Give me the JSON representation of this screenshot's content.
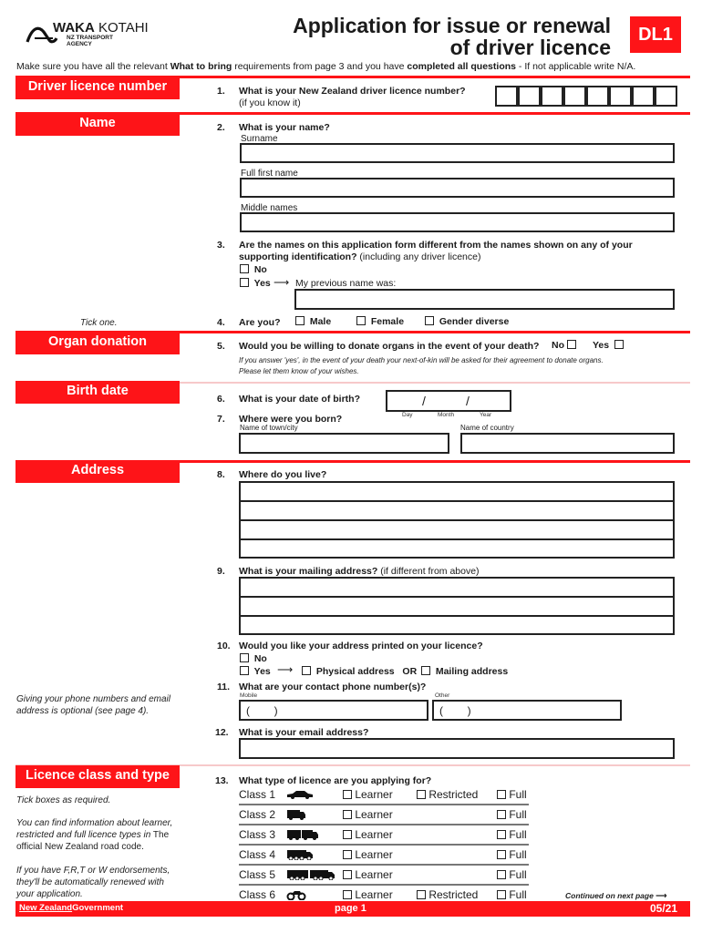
{
  "header": {
    "logo": {
      "brand_bold": "WAKA",
      "brand_light": "KOTAHI",
      "sub1": "NZ TRANSPORT",
      "sub2": "AGENCY",
      "icon": "waka-kotahi-logo-icon"
    },
    "title_line1": "Application for issue or renewal",
    "title_line2": "of driver licence",
    "form_code": "DL1",
    "instruction_pre": "Make sure you have all the relevant ",
    "instruction_bold1": "What to bring",
    "instruction_mid": " requirements from page 3 and you have ",
    "instruction_bold2": "completed all questions",
    "instruction_post": " - If not applicable write N/A.",
    "accent_color": "#fe1418"
  },
  "sections": {
    "licence_number": "Driver licence number",
    "name": "Name",
    "organ": "Organ donation",
    "birth": "Birth date",
    "address": "Address",
    "licence_class": "Licence class and type"
  },
  "side_notes": {
    "tick_one": "Tick one.",
    "phone_optional": "Giving your phone numbers and email address is optional (see page 4).",
    "tick_boxes": "Tick boxes as required.",
    "info_italic": "You can find information about learner, restricted and full licence types in",
    "info_normal": " The official New Zealand road code.",
    "endorsements": "If you have F,R,T or W endorsements, they'll be automatically renewed with your application."
  },
  "questions": {
    "q1": {
      "num": "1.",
      "text": "What is your New Zealand driver licence number?",
      "sub": "(if you know it)",
      "boxes": 8
    },
    "q2": {
      "num": "2.",
      "text": "What is your name?",
      "surname": "Surname",
      "first": "Full first name",
      "middle": "Middle names"
    },
    "q3": {
      "num": "3.",
      "text1": "Are the names on this application form different from the names shown on any of your",
      "text2": "supporting identification?",
      "text2_note": " (including any driver licence)",
      "no": "No",
      "yes": "Yes",
      "previous": "My previous name was:"
    },
    "q4": {
      "num": "4.",
      "text": "Are you?",
      "options": [
        "Male",
        "Female",
        "Gender diverse"
      ]
    },
    "q5": {
      "num": "5.",
      "text": "Would you be willing to donate organs in the event of your death?",
      "no": "No",
      "yes": "Yes",
      "note1": "If you answer 'yes', in the event of your death your next-of-kin will be asked for their agreement to donate organs.",
      "note2": "Please let them know of your wishes."
    },
    "q6": {
      "num": "6.",
      "text": "What is your date of birth?",
      "slash": "/",
      "day": "Day",
      "month": "Month",
      "year": "Year"
    },
    "q7": {
      "num": "7.",
      "text": "Where were you born?",
      "town": "Name of town/city",
      "country": "Name of country"
    },
    "q8": {
      "num": "8.",
      "text": "Where do you live?"
    },
    "q9": {
      "num": "9.",
      "text": "What is your mailing address?",
      "note": " (if different from above)"
    },
    "q10": {
      "num": "10.",
      "text": "Would you like your address printed on your licence?",
      "no": "No",
      "yes": "Yes",
      "physical": "Physical address",
      "or": "OR",
      "mailing": "Mailing address"
    },
    "q11": {
      "num": "11.",
      "text": "What are your contact phone number(s)?",
      "mobile": "Mobile",
      "other": "Other",
      "paren": "(        )"
    },
    "q12": {
      "num": "12.",
      "text": "What is your email address?"
    },
    "q13": {
      "num": "13.",
      "text": "What type of licence are you applying for?"
    }
  },
  "licence_classes": [
    {
      "label": "Class 1",
      "vehicle_icon": "car-icon",
      "learner": "Learner",
      "restricted": "Restricted",
      "full": "Full"
    },
    {
      "label": "Class 2",
      "vehicle_icon": "truck-icon",
      "learner": "Learner",
      "restricted": null,
      "full": "Full"
    },
    {
      "label": "Class 3",
      "vehicle_icon": "truck-trailer-icon",
      "learner": "Learner",
      "restricted": null,
      "full": "Full"
    },
    {
      "label": "Class 4",
      "vehicle_icon": "heavy-truck-icon",
      "learner": "Learner",
      "restricted": null,
      "full": "Full"
    },
    {
      "label": "Class 5",
      "vehicle_icon": "heavy-combination-icon",
      "learner": "Learner",
      "restricted": null,
      "full": "Full"
    },
    {
      "label": "Class 6",
      "vehicle_icon": "motorcycle-icon",
      "learner": "Learner",
      "restricted": "Restricted",
      "full": "Full"
    }
  ],
  "footer": {
    "gov_link": "New Zealand",
    "gov_text": "Government",
    "page": "page 1",
    "version": "05/21",
    "continued": "Continued on next page"
  }
}
